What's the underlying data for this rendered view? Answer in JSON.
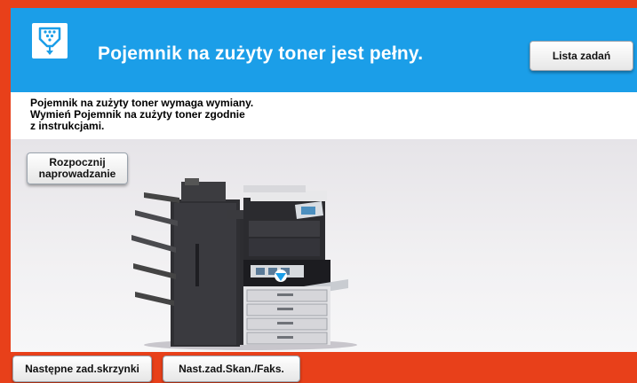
{
  "header": {
    "title": "Pojemnik na zużyty toner jest pełny.",
    "job_list_label": "Lista zadań",
    "icon": "waste-toner-icon"
  },
  "message": {
    "lines": [
      "Pojemnik na zużyty toner wymaga wymiany.",
      "Wymień Pojemnik na zużyty toner zgodnie",
      "z instrukcjami."
    ]
  },
  "guide_button": {
    "line1": "Rozpocznij",
    "line2": "naprowadzanie"
  },
  "footer": {
    "next_box_label": "Następne zad.skrzynki",
    "next_scan_label": "Nast.zad.Skan./Faks."
  },
  "colors": {
    "frame": "#e8401a",
    "header": "#1b9ee8",
    "panel": "#ffffff"
  }
}
